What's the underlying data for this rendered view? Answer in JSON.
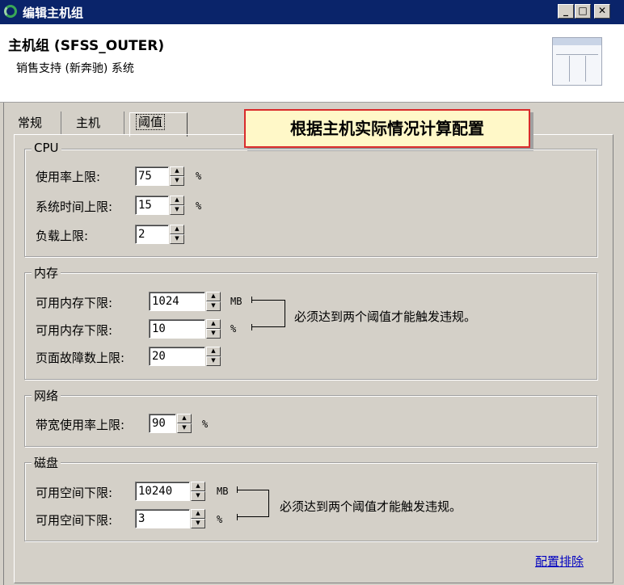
{
  "window": {
    "title": "编辑主机组",
    "app_icon": "refresh-icon",
    "minimize_glyph": "_",
    "maximize_glyph": "□",
    "close_glyph": "✕"
  },
  "header": {
    "title": "主机组 (SFSS_OUTER)",
    "subtitle": "销售支持 (新奔驰) 系统",
    "icon": "table-window-icon"
  },
  "tabs": [
    {
      "label": "常规",
      "active": false
    },
    {
      "label": "主机",
      "active": false
    },
    {
      "label": "阈值",
      "active": true
    }
  ],
  "callout": "根据主机实际情况计算配置",
  "cpu": {
    "legend": "CPU",
    "usage_label": "使用率上限:",
    "usage_value": "75",
    "usage_unit": "%",
    "systime_label": "系统时间上限:",
    "systime_value": "15",
    "systime_unit": "%",
    "load_label": "负载上限:",
    "load_value": "2"
  },
  "memory": {
    "legend": "内存",
    "avail_mb_label": "可用内存下限:",
    "avail_mb_value": "1024",
    "avail_mb_unit": "MB",
    "avail_pct_label": "可用内存下限:",
    "avail_pct_value": "10",
    "avail_pct_unit": "%",
    "pagefault_label": "页面故障数上限:",
    "pagefault_value": "20",
    "note": "必须达到两个阈值才能触发违规。"
  },
  "network": {
    "legend": "网络",
    "bw_label": "带宽使用率上限:",
    "bw_value": "90",
    "bw_unit": "%"
  },
  "disk": {
    "legend": "磁盘",
    "space_mb_label": "可用空间下限:",
    "space_mb_value": "10240",
    "space_mb_unit": "MB",
    "space_pct_label": "可用空间下限:",
    "space_pct_value": "3",
    "space_pct_unit": "%",
    "note": "必须达到两个阈值才能触发违规。"
  },
  "footer": {
    "link": "配置排除"
  },
  "colors": {
    "titlebar": "#0a246a",
    "dialog_bg": "#d4d0c8",
    "callout_border": "#d92b2b",
    "callout_bg": "#fff8c8",
    "link": "#0000c0"
  }
}
